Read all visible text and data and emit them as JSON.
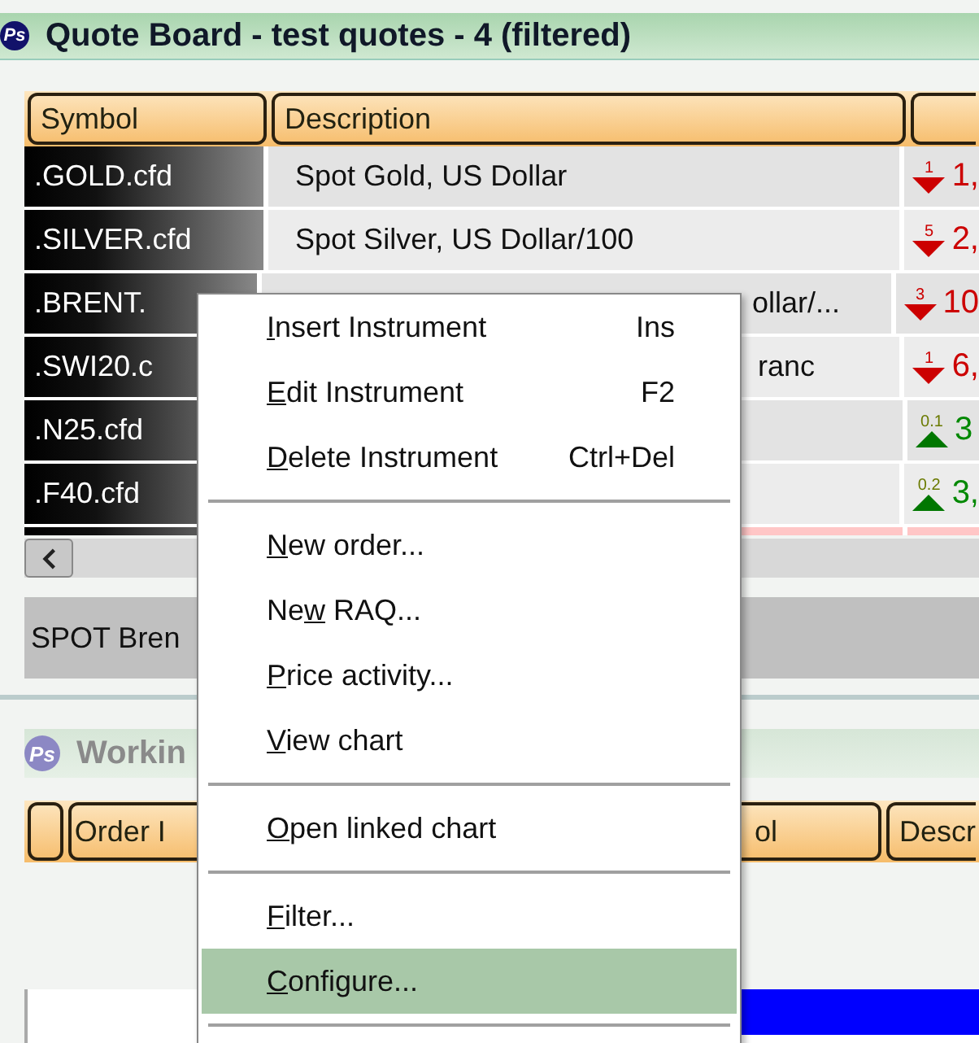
{
  "quote_board": {
    "logo": "Ps",
    "title": "Quote Board - test quotes - 4 (filtered)",
    "columns": [
      "Symbol",
      "Description"
    ],
    "rows": [
      {
        "symbol": ".GOLD.cfd",
        "description": "Spot Gold, US Dollar",
        "covered_left": false,
        "change": {
          "kind": "down",
          "step": "1",
          "value": "1,"
        },
        "highlighted": false
      },
      {
        "symbol": ".SILVER.cfd",
        "description": "Spot Silver, US Dollar/100",
        "covered_left": false,
        "change": {
          "kind": "down",
          "step": "5",
          "value": "2,"
        },
        "highlighted": false
      },
      {
        "symbol": ".BRENT.",
        "description": "ollar/...",
        "covered_left": true,
        "change": {
          "kind": "down",
          "step": "3",
          "value": "10"
        },
        "highlighted": false
      },
      {
        "symbol": ".SWI20.c",
        "description": "ranc",
        "covered_left": true,
        "change": {
          "kind": "down",
          "step": "1",
          "value": "6,"
        },
        "highlighted": false
      },
      {
        "symbol": ".N25.cfd",
        "change": {
          "kind": "up",
          "step": "0.1",
          "value": "3"
        },
        "highlighted": false
      },
      {
        "symbol": ".F40.cfd",
        "change": {
          "kind": "up",
          "step": "0.2",
          "value": "3,"
        },
        "highlighted": false
      },
      {
        "highlighted": true
      }
    ],
    "status_bar": "SPOT Bren"
  },
  "working_orders": {
    "logo": "Ps",
    "title": "Workin",
    "columns": [
      "Order I",
      "ol",
      "Descr"
    ]
  },
  "context_menu": [
    {
      "kind": "item",
      "access_key": "I",
      "label_rest": "nsert Instrument",
      "shortcut": "Ins",
      "selected": false
    },
    {
      "kind": "item",
      "access_key": "E",
      "label_rest": "dit Instrument",
      "shortcut": "F2",
      "selected": false
    },
    {
      "kind": "item",
      "access_key": "D",
      "label_rest": "elete Instrument",
      "shortcut": "Ctrl+Del",
      "selected": false
    },
    {
      "kind": "separator"
    },
    {
      "kind": "item",
      "access_key": "N",
      "label_rest": "ew order...",
      "selected": false
    },
    {
      "kind": "item",
      "label_start": "Ne",
      "access_key": "w",
      "label_rest": " RAQ...",
      "selected": false
    },
    {
      "kind": "item",
      "access_key": "P",
      "label_rest": "rice activity...",
      "selected": false
    },
    {
      "kind": "item",
      "access_key": "V",
      "label_rest": "iew chart",
      "selected": false
    },
    {
      "kind": "separator"
    },
    {
      "kind": "item",
      "access_key": "O",
      "label_rest": "pen linked chart",
      "selected": false
    },
    {
      "kind": "separator"
    },
    {
      "kind": "item",
      "access_key": "F",
      "label_rest": "ilter...",
      "selected": false
    },
    {
      "kind": "item",
      "access_key": "C",
      "label_rest": "onfigure...",
      "selected": true
    },
    {
      "kind": "separator"
    }
  ]
}
